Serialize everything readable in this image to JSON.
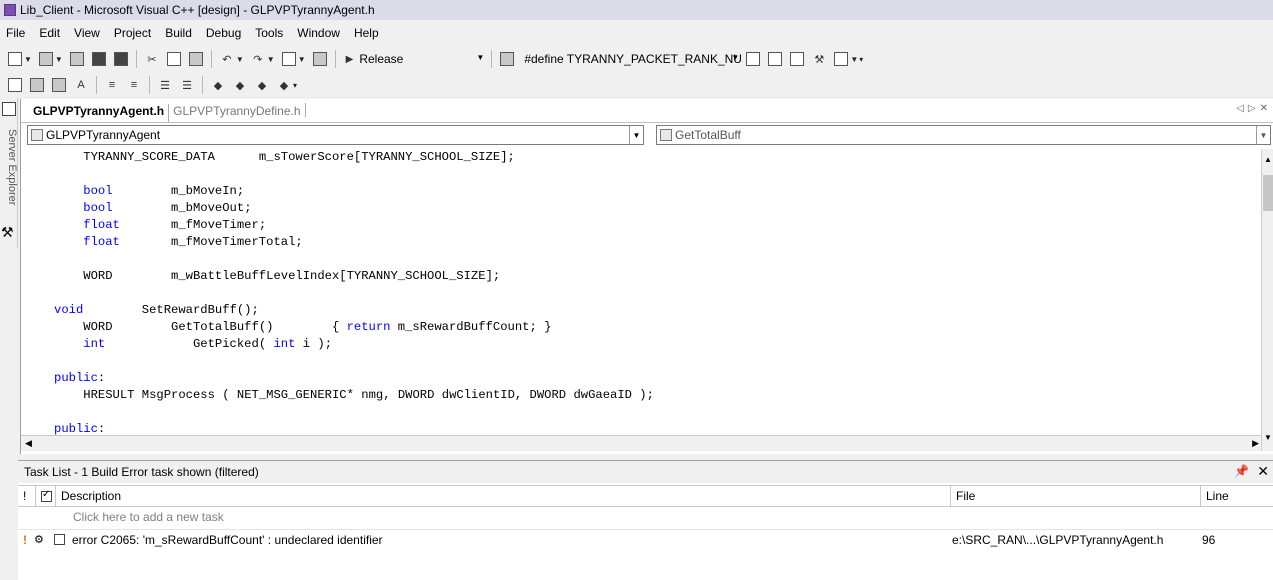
{
  "window": {
    "title": "Lib_Client - Microsoft Visual C++ [design] - GLPVPTyrannyAgent.h"
  },
  "menu": [
    "File",
    "Edit",
    "View",
    "Project",
    "Build",
    "Debug",
    "Tools",
    "Window",
    "Help"
  ],
  "toolbar": {
    "config": "Release",
    "define": "#define TYRANNY_PACKET_RANK_NU"
  },
  "sidebar": {
    "server_explorer": "Server Explorer"
  },
  "tabs": [
    {
      "label": "GLPVPTyrannyAgent.h",
      "active": true
    },
    {
      "label": "GLPVPTyrannyDefine.h",
      "active": false
    }
  ],
  "navbar": {
    "class_combo": "GLPVPTyrannyAgent",
    "member_combo": "GetTotalBuff"
  },
  "code": {
    "lines": [
      "    TYRANNY_SCORE_DATA      m_sTowerScore[TYRANNY_SCHOOL_SIZE];",
      "",
      "    bool        m_bMoveIn;",
      "    bool        m_bMoveOut;",
      "    float       m_fMoveTimer;",
      "    float       m_fMoveTimerTotal;",
      "",
      "    WORD        m_wBattleBuffLevelIndex[TYRANNY_SCHOOL_SIZE];",
      "",
      "void        SetRewardBuff();",
      "    WORD        GetTotalBuff()        { return m_sRewardBuffCount; }",
      "    int            GetPicked( int i );",
      "",
      "public:",
      "    HRESULT MsgProcess ( NET_MSG_GENERIC* nmg, DWORD dwClientID, DWORD dwGaeaID );",
      "",
      "public:"
    ],
    "keywords": [
      "bool",
      "float",
      "void",
      "int",
      "return",
      "public"
    ]
  },
  "tasklist": {
    "title": "Task List - 1 Build Error task shown (filtered)",
    "columns": {
      "bang": "!",
      "description": "Description",
      "file": "File",
      "line": "Line"
    },
    "add_placeholder": "Click here to add a new task",
    "rows": [
      {
        "description": "error C2065: 'm_sRewardBuffCount' : undeclared identifier",
        "file": "e:\\SRC_RAN\\...\\GLPVPTyrannyAgent.h",
        "line": "96"
      }
    ]
  }
}
